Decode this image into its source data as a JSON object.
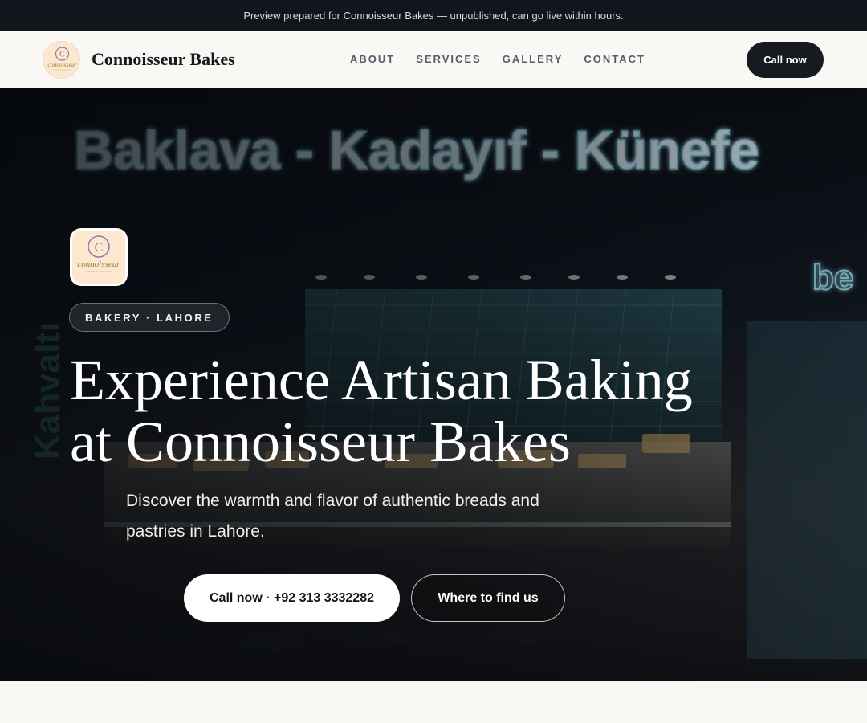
{
  "banner": {
    "text": "Preview prepared for Connoisseur Bakes — unpublished, can go live within hours."
  },
  "header": {
    "brand_name": "Connoisseur Bakes",
    "logo_icon": "connoisseur-logo",
    "nav": [
      "ABOUT",
      "SERVICES",
      "GALLERY",
      "CONTACT"
    ],
    "cta_label": "Call now"
  },
  "hero": {
    "background_image": "bakery-storefront-photo",
    "sign_text": "Baklava - Kadayıf - Künefe",
    "side_sign_text": "Kahvaltı",
    "badge": "BAKERY · LAHORE",
    "title_line1": "Experience Artisan Baking",
    "title_line2": "at Connoisseur Bakes",
    "subtitle": "Discover the warmth and flavor of authentic breads and pastries in Lahore.",
    "primary_button": "Call now · +92 313 3332282",
    "secondary_button": "Where to find us"
  },
  "colors": {
    "banner_bg": "#12151b",
    "nav_bg": "#faf8f5",
    "accent_dark": "#171a21",
    "neon_sign": "#7fd8f2",
    "logo_bg": "#fde7cf"
  }
}
